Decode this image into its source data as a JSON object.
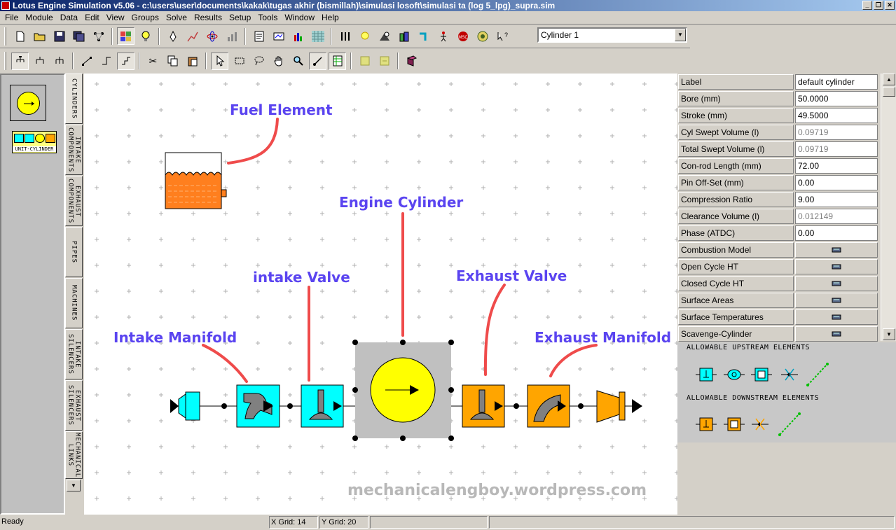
{
  "window": {
    "title": "Lotus Engine Simulation v5.06 - c:\\users\\user\\documents\\kakak\\tugas akhir (bismillah)\\simulasi losoft\\simulasi ta (log 5_lpg)_supra.sim",
    "controls": [
      "_",
      "❐",
      "✕"
    ]
  },
  "menu": [
    "File",
    "Module",
    "Data",
    "Edit",
    "View",
    "Groups",
    "Solve",
    "Results",
    "Setup",
    "Tools",
    "Window",
    "Help"
  ],
  "toolbar": {
    "row1_icons": [
      "new-file",
      "open-folder",
      "save",
      "save-all",
      "network",
      "data-view",
      "lightbulb",
      "rocket",
      "chart",
      "atom",
      "bars",
      "report",
      "ts-tool",
      "graph",
      "grid-pattern",
      "valve-tool",
      "light-tool",
      "pump",
      "building",
      "pipe-tool",
      "figure",
      "msc-badge",
      "lotus-logo",
      "help-pointer"
    ],
    "row2_icons": [
      "arrange-1",
      "arrange-2",
      "arrange-3",
      "connect-1",
      "connect-2",
      "connect-3",
      "cut",
      "copy",
      "paste",
      "pointer",
      "rect-select",
      "lasso",
      "hand",
      "zoom",
      "link",
      "sheet",
      "block-a",
      "block-b",
      "book"
    ],
    "element_selector": "Cylinder 1"
  },
  "palette": {
    "unit_label": "UNIT-CYLINDER",
    "tabs": [
      "CYLINDERS",
      "INTAKE\nCOMPONENTS",
      "EXHAUST\nCOMPONENTS",
      "PIPES",
      "MACHINES",
      "INTAKE\nSILENCERS",
      "EXHAUST\nSILENCERS",
      "MECHANICAL\nLINKS"
    ],
    "scroll_icon": "▼"
  },
  "annotations": {
    "fuel": "Fuel Element",
    "cylinder": "Engine Cylinder",
    "intake_valve": "intake Valve",
    "exhaust_valve": "Exhaust Valve",
    "intake_manifold": "Intake Manifold",
    "exhaust_manifold": "Exhaust Manifold"
  },
  "watermark": "mechanicalengboy.wordpress.com",
  "colors": {
    "intake": "#00ffff",
    "exhaust": "#ffa500",
    "cylinder": "#ffff00",
    "fuel": "#ff7f1e",
    "annotation_text": "#5a44f0",
    "annotation_line": "#ef4b4b"
  },
  "properties": [
    {
      "label": "Label",
      "value": "default cylinder",
      "type": "text"
    },
    {
      "label": "Bore (mm)",
      "value": "50.0000",
      "type": "text"
    },
    {
      "label": "Stroke (mm)",
      "value": "49.5000",
      "type": "text"
    },
    {
      "label": "Cyl Swept Volume (l)",
      "value": "0.09719",
      "type": "readonly"
    },
    {
      "label": "Total Swept Volume (l)",
      "value": "0.09719",
      "type": "readonly"
    },
    {
      "label": "Con-rod Length (mm)",
      "value": "72.00",
      "type": "text"
    },
    {
      "label": "Pin Off-Set (mm)",
      "value": "0.00",
      "type": "text"
    },
    {
      "label": "Compression Ratio",
      "value": "9.00",
      "type": "text"
    },
    {
      "label": "Clearance Volume (l)",
      "value": "0.012149",
      "type": "readonly"
    },
    {
      "label": "Phase (ATDC)",
      "value": "0.00",
      "type": "text"
    },
    {
      "label": "Combustion Model",
      "value": "",
      "type": "button"
    },
    {
      "label": "Open Cycle HT",
      "value": "",
      "type": "button"
    },
    {
      "label": "Closed Cycle HT",
      "value": "",
      "type": "button"
    },
    {
      "label": "Surface Areas",
      "value": "",
      "type": "button"
    },
    {
      "label": "Surface Temperatures",
      "value": "",
      "type": "button"
    },
    {
      "label": "Scavenge-Cylinder",
      "value": "",
      "type": "button"
    }
  ],
  "allowable": {
    "upstream_title": "ALLOWABLE UPSTREAM ELEMENTS",
    "downstream_title": "ALLOWABLE DOWNSTREAM ELEMENTS"
  },
  "status": {
    "text": "Ready",
    "x_grid": "X Grid: 14",
    "y_grid": "Y Grid: 20"
  }
}
